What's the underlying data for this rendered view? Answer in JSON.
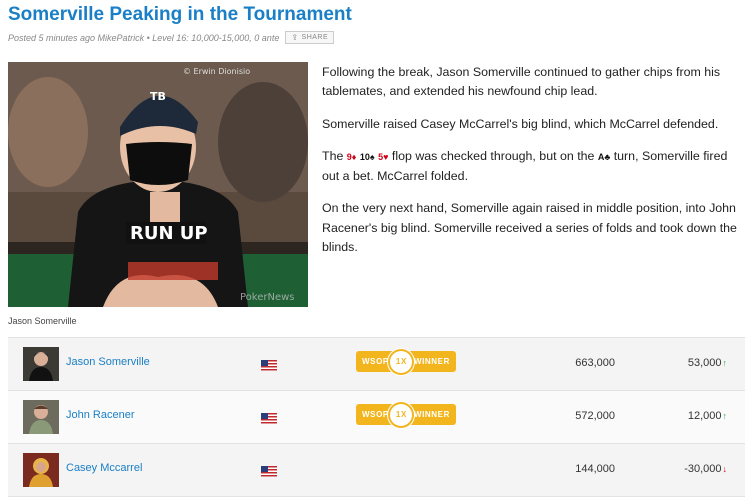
{
  "post": {
    "title": "Somerville Peaking in the Tournament",
    "meta": "Posted 5 minutes ago MikePatrick • Level 16: 10,000-15,000, 0 ante",
    "share_label": "SHARE"
  },
  "photo": {
    "credit": "© Erwin Dionisio",
    "watermark": "PokerNews",
    "shirt_text": "RUN UP",
    "hat_logo": "TB",
    "caption": "Jason Somerville"
  },
  "article": {
    "p1": "Following the break, Jason Somerville continued to gather chips from his tablemates, and extended his newfound chip lead.",
    "p2": "Somerville raised Casey McCarrel's big blind, which McCarrel defended.",
    "p3_pre": "The ",
    "p3_flop_c1": "9♦",
    "p3_flop_c2": "10♠",
    "p3_flop_c3": "5♥",
    "p3_mid": " flop was checked through, but on the ",
    "p3_turn": "A♣",
    "p3_post": " turn, Somerville fired out a bet. McCarrel folded.",
    "p4": "On the very next hand, Somerville again raised in middle position, into John Racener's big blind. Somerville received a series of folds and took down the blinds."
  },
  "players": [
    {
      "name": "Jason Somerville",
      "badge_left": "WSOP",
      "badge_mid": "1X",
      "badge_right": "WINNER",
      "chips": "663,000",
      "change": "53,000",
      "direction": "up"
    },
    {
      "name": "John Racener",
      "badge_left": "WSOP",
      "badge_mid": "1X",
      "badge_right": "WINNER",
      "chips": "572,000",
      "change": "12,000",
      "direction": "up"
    },
    {
      "name": "Casey Mccarrel",
      "chips": "144,000",
      "change": "-30,000",
      "direction": "down"
    }
  ],
  "colors": {
    "link": "#1a7fc6",
    "badge": "#f2b51d",
    "up": "#2aa84a",
    "down": "#d0021b"
  }
}
